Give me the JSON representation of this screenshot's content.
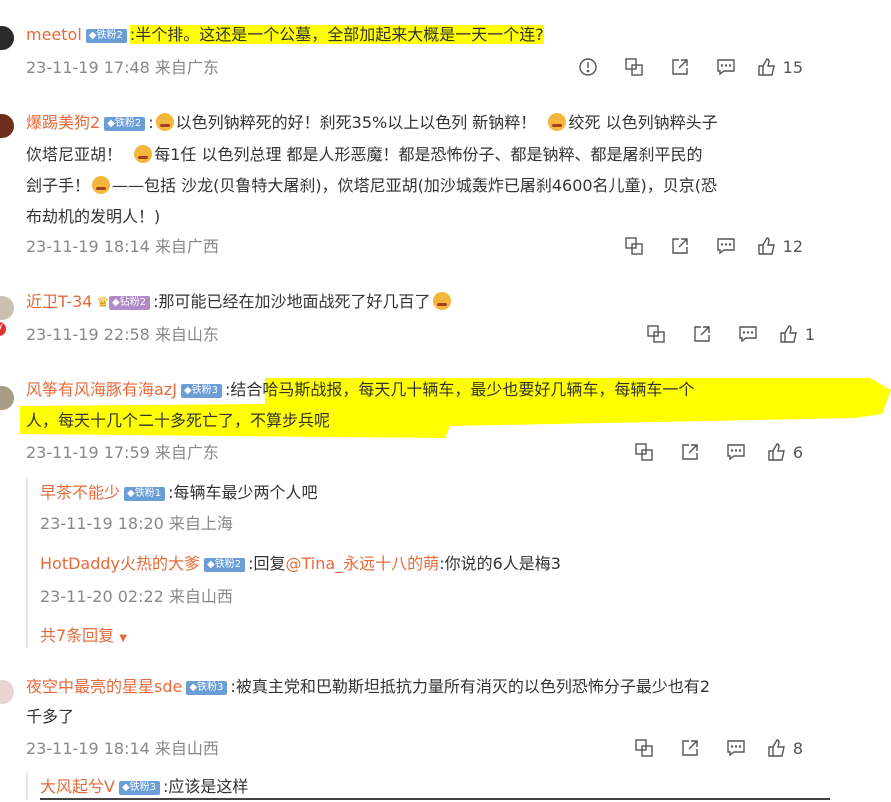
{
  "comments": [
    {
      "user": "meetol",
      "badge": "铁粉2",
      "line1": ":半个排。这还是一个公墓，全部加起来大概是一天一个连?",
      "time": "23-11-19 17:48 来自广东",
      "likes": "15"
    },
    {
      "user": "爆踢美狗2",
      "badge": "铁粉2",
      "seg_a": ":",
      "seg_b": "以色列钠粹死的好！刹死35%以上以色列 新钠粹！",
      "seg_c": "绞死 以色列钠粹头子",
      "seg_d": "佽塔尼亚胡！",
      "seg_e": "每1任 以色列总理 都是人形恶魔！都是恐怖份子、都是钠粹、都是屠刹平民的",
      "seg_f": "刽子手！",
      "seg_g": "——包括 沙龙(贝鲁特大屠刹)，佽塔尼亚胡(加沙城轰炸已屠刹4600名儿童)，贝京(恐",
      "seg_h": "布劫机的发明人！)",
      "time": "23-11-19 18:14 来自广西",
      "likes": "12"
    },
    {
      "user": "近卫T-34",
      "badge": "钻粉2",
      "line1": ":那可能已经在加沙地面战死了好几百了",
      "time": "23-11-19 22:58 来自山东",
      "likes": "1"
    },
    {
      "user": "风筝有风海豚有海azJ",
      "badge": "铁粉3",
      "line1": ":结合哈马斯战报，每天几十辆车，最少也要好几辆车，每辆车一个",
      "line2": "人，每天十几个二十多死亡了，不算步兵呢",
      "time": "23-11-19 17:59 来自广东",
      "likes": "6",
      "replies": [
        {
          "user": "早茶不能少",
          "badge": "铁粉1",
          "text": ":每辆车最少两个人吧",
          "time": "23-11-19 18:20 来自上海"
        },
        {
          "user": "HotDaddy火热的大爹",
          "badge": "铁粉2",
          "text_a": ":回复",
          "at": "@Tina_永远十八的萌",
          "text_b": ":你说的6人是梅3",
          "time": "23-11-20 02:22 来自山西"
        }
      ],
      "more": "共7条回复"
    },
    {
      "user": "夜空中最亮的星星sde",
      "badge": "铁粉3",
      "line1": ":被真主党和巴勒斯坦抵抗力量所有消灭的以色列恐怖分子最少也有2",
      "line2": "千多了",
      "time": "23-11-19 18:14 来自山西",
      "likes": "8",
      "replies": [
        {
          "user": "大风起兮V",
          "badge": "铁粉3",
          "text": ":应该是这样"
        }
      ]
    }
  ],
  "colors": {
    "username": "#e86a3a",
    "highlight": "#ffff00",
    "badge": "#6b9ed6"
  },
  "icons": [
    "report-icon",
    "translate-icon",
    "share-icon",
    "comment-icon",
    "like-icon"
  ]
}
